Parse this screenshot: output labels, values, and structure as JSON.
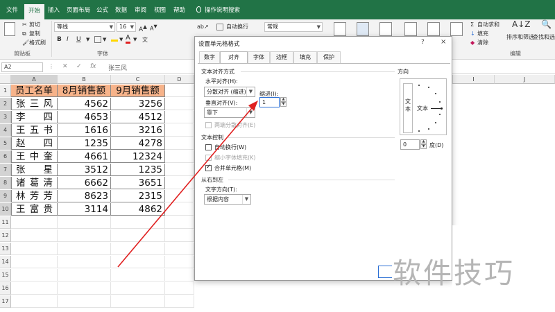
{
  "ribbon_tabs": [
    "文件",
    "开始",
    "插入",
    "页面布局",
    "公式",
    "数据",
    "审阅",
    "视图",
    "帮助",
    "操作说明搜索"
  ],
  "ribbon": {
    "clipboard": {
      "cut": "剪切",
      "copy": "复制",
      "format_painter": "格式刷",
      "group_label": "剪贴板"
    },
    "font": {
      "name": "等线",
      "size": "16",
      "bold": "B",
      "italic": "I",
      "underline": "U",
      "font_color_letter": "A",
      "phonetic": "文",
      "group_label": "字体"
    },
    "alignment": {
      "wrap_text": "自动换行"
    },
    "number": {
      "format": "常规"
    },
    "editing": {
      "autosum": "自动求和",
      "fill": "填充",
      "clear": "清除",
      "sort_filter": "排序和筛选",
      "find_select": "查找和选",
      "group_label": "编辑"
    }
  },
  "formula_bar": {
    "name_box": "A2",
    "fx": "fx",
    "content": "张三风"
  },
  "grid": {
    "columns": [
      "A",
      "B",
      "C",
      "D"
    ],
    "rows": [
      "1",
      "2",
      "3",
      "4",
      "5",
      "6",
      "7",
      "8",
      "9",
      "10",
      "11",
      "12",
      "13",
      "14",
      "15",
      "16",
      "17"
    ],
    "headers": [
      "员工名单",
      "8月销售额",
      "9月销售额"
    ],
    "data": [
      [
        "张三风",
        "4562",
        "3256"
      ],
      [
        "李四",
        "4653",
        "4512"
      ],
      [
        "王五书",
        "1616",
        "3216"
      ],
      [
        "赵四",
        "1235",
        "4278"
      ],
      [
        "王中奎",
        "4661",
        "12324"
      ],
      [
        "张星",
        "3512",
        "1235"
      ],
      [
        "诸葛清",
        "6662",
        "3651"
      ],
      [
        "林芳芳",
        "8623",
        "2315"
      ],
      [
        "王富贵",
        "3114",
        "4862"
      ]
    ]
  },
  "dialog": {
    "title": "设置单元格格式",
    "help": "?",
    "close": "×",
    "tabs": [
      "数字",
      "对齐",
      "字体",
      "边框",
      "填充",
      "保护"
    ],
    "text_alignment": {
      "section": "文本对齐方式",
      "horizontal_label": "水平对齐(H):",
      "horizontal_value": "分散对齐 (缩进)",
      "indent_label": "缩进(I):",
      "indent_value": "1",
      "vertical_label": "垂直对齐(V):",
      "vertical_value": "靠下",
      "justify_distributed": "两端分散对齐(E)"
    },
    "text_control": {
      "section": "文本控制",
      "wrap_text": "自动换行(W)",
      "shrink_to_fit": "缩小字体填充(K)",
      "merge_cells": "合并单元格(M)"
    },
    "rtl": {
      "section": "从右到左",
      "direction_label": "文字方向(T):",
      "direction_value": "根据内容"
    },
    "orientation": {
      "section": "方向",
      "vertical_text": "文本",
      "horizontal_text": "文本",
      "degrees_value": "0",
      "degrees_label": "度(D)"
    }
  },
  "watermark": "软件技巧",
  "colors": {
    "ribbon_green": "#217346",
    "header_fill": "#f7b38a",
    "arrow_red": "#e02020"
  }
}
